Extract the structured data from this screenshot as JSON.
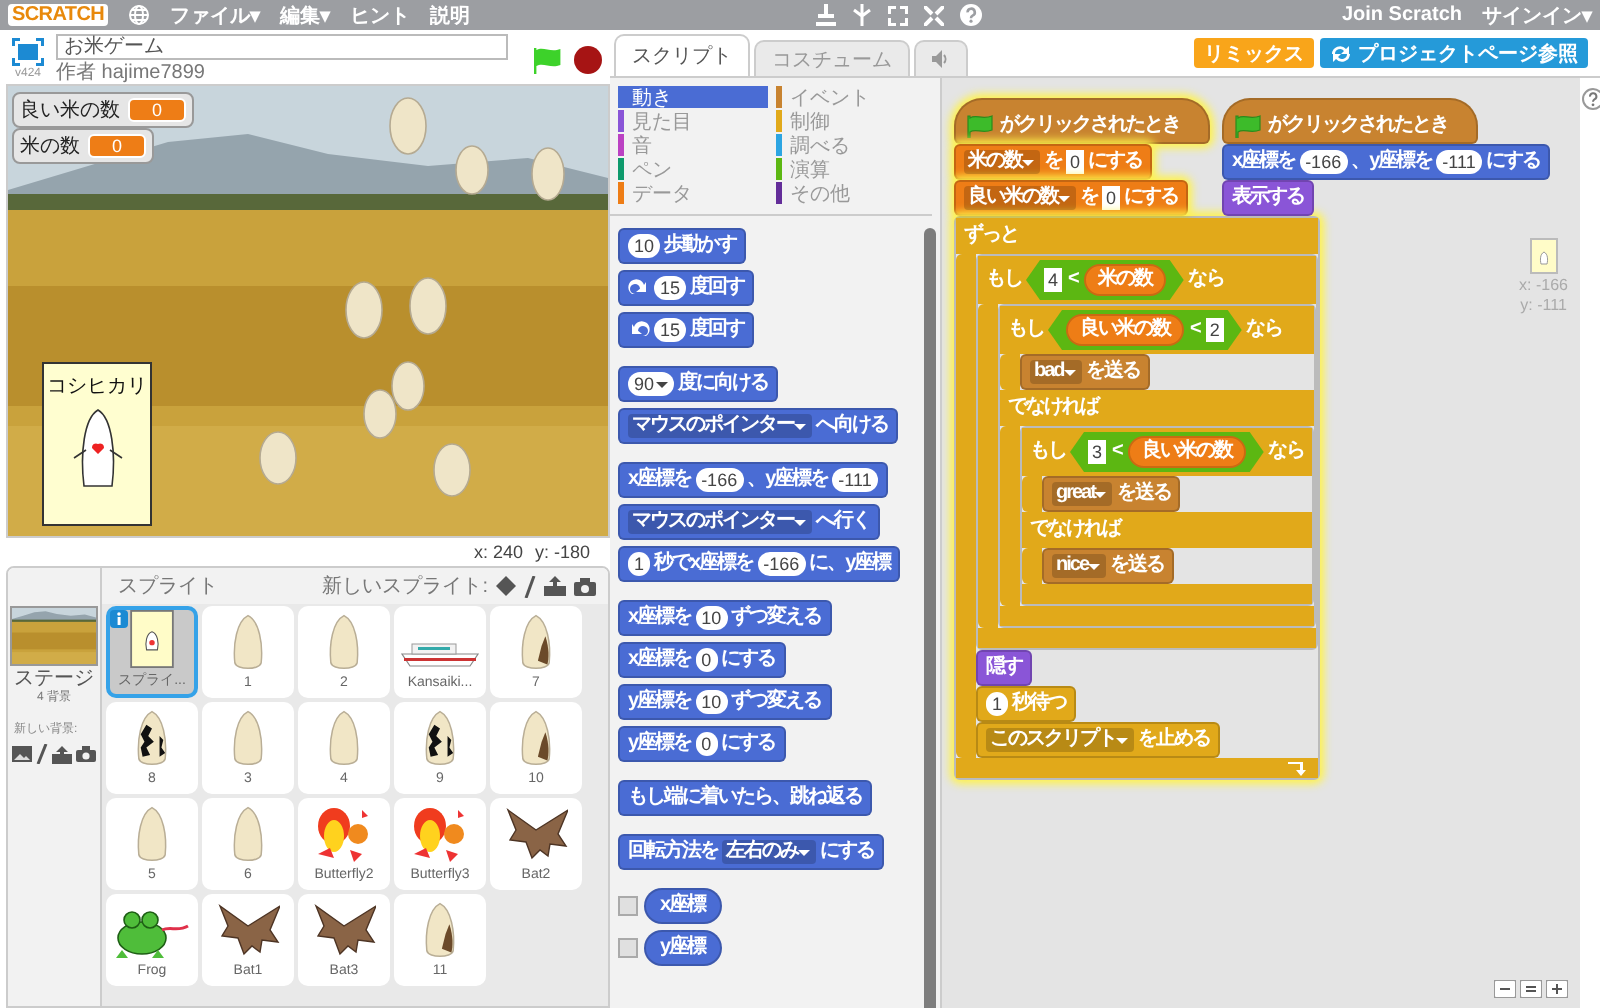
{
  "menubar": {
    "logo": "SCRATCH",
    "menus": [
      "ファイル▾",
      "編集▾",
      "ヒント",
      "説明"
    ],
    "account": [
      "Join Scratch",
      "サインイン▾"
    ]
  },
  "project": {
    "title": "お米ゲーム",
    "author": "作者 hajime7899",
    "version": "v424"
  },
  "stage": {
    "monitors": [
      {
        "label": "良い米の数",
        "value": "0"
      },
      {
        "label": "米の数",
        "value": "0"
      }
    ],
    "card_text": "コシヒカリ",
    "readout_x": "x: 240",
    "readout_y": "y: -180"
  },
  "sprites_pane": {
    "stage_label": "ステージ",
    "backdrop_count": "4 背景",
    "new_backdrop": "新しい背景:",
    "title": "スプライト",
    "new_sprite": "新しいスプライト:",
    "sprites": [
      {
        "name": "スプライ...",
        "kind": "card",
        "selected": true
      },
      {
        "name": "1",
        "kind": "grain",
        "selected": false
      },
      {
        "name": "2",
        "kind": "grain",
        "selected": false
      },
      {
        "name": "Kansaiki...",
        "kind": "ship",
        "selected": false
      },
      {
        "name": "7",
        "kind": "brown-grain",
        "selected": false
      },
      {
        "name": "8",
        "kind": "spotted-grain",
        "selected": false
      },
      {
        "name": "3",
        "kind": "grain",
        "selected": false
      },
      {
        "name": "4",
        "kind": "grain",
        "selected": false
      },
      {
        "name": "9",
        "kind": "spotted-grain",
        "selected": false
      },
      {
        "name": "10",
        "kind": "brown-grain",
        "selected": false
      },
      {
        "name": "5",
        "kind": "grain",
        "selected": false
      },
      {
        "name": "6",
        "kind": "grain",
        "selected": false
      },
      {
        "name": "Butterfly2",
        "kind": "dragon",
        "selected": false
      },
      {
        "name": "Butterfly3",
        "kind": "dragon",
        "selected": false
      },
      {
        "name": "Bat2",
        "kind": "bat",
        "selected": false
      },
      {
        "name": "Frog",
        "kind": "frog",
        "selected": false
      },
      {
        "name": "Bat1",
        "kind": "bat",
        "selected": false
      },
      {
        "name": "Bat3",
        "kind": "bat",
        "selected": false
      },
      {
        "name": "11",
        "kind": "brown-grain",
        "selected": false
      }
    ]
  },
  "tabs": [
    {
      "kind": "text",
      "label": "スクリプト",
      "selected": true
    },
    {
      "kind": "text",
      "label": "コスチューム",
      "selected": false
    },
    {
      "kind": "sound",
      "selected": false
    }
  ],
  "buttons": [
    {
      "kind": "remix",
      "label": "リミックス"
    },
    {
      "kind": "project-page",
      "label": "プロジェクトページ参照"
    }
  ],
  "palette": {
    "categories": [
      {
        "label": "動き",
        "color": "#4a6cd4",
        "selected": true
      },
      {
        "label": "見た目",
        "color": "#8a55d7",
        "selected": false
      },
      {
        "label": "音",
        "color": "#bb42c3",
        "selected": false
      },
      {
        "label": "ペン",
        "color": "#0e9a6c",
        "selected": false
      },
      {
        "label": "データ",
        "color": "#ee7d16",
        "selected": false
      },
      {
        "label": "イベント",
        "color": "#c88330",
        "selected": false
      },
      {
        "label": "制御",
        "color": "#e1a91a",
        "selected": false
      },
      {
        "label": "調べる",
        "color": "#2ca5e2",
        "selected": false
      },
      {
        "label": "演算",
        "color": "#5cb712",
        "selected": false
      },
      {
        "label": "その他",
        "color": "#632d99",
        "selected": false
      }
    ],
    "groups": [
      [
        {
          "kind": "stack",
          "color": "#4a6cd4",
          "parts": [
            {
              "kind": "number",
              "text": "10"
            },
            {
              "kind": "text",
              "text": "歩動かす"
            }
          ]
        },
        {
          "kind": "stack",
          "color": "#4a6cd4",
          "parts": [
            {
              "kind": "turn-right"
            },
            {
              "kind": "number",
              "text": "15"
            },
            {
              "kind": "text",
              "text": "度回す"
            }
          ]
        },
        {
          "kind": "stack",
          "color": "#4a6cd4",
          "parts": [
            {
              "kind": "turn-left"
            },
            {
              "kind": "number",
              "text": "15"
            },
            {
              "kind": "text",
              "text": "度回す"
            }
          ]
        }
      ],
      [
        {
          "kind": "stack",
          "color": "#4a6cd4",
          "parts": [
            {
              "kind": "numdrop",
              "text": "90"
            },
            {
              "kind": "text",
              "text": "度に向ける"
            }
          ]
        },
        {
          "kind": "stack",
          "color": "#4a6cd4",
          "parts": [
            {
              "kind": "dropdown",
              "text": "マウスのポインター"
            },
            {
              "kind": "text",
              "text": "へ向ける"
            }
          ]
        }
      ],
      [
        {
          "kind": "stack",
          "color": "#4a6cd4",
          "parts": [
            {
              "kind": "text",
              "text": "x座標を"
            },
            {
              "kind": "number",
              "text": "-166"
            },
            {
              "kind": "text",
              "text": "、y座標を"
            },
            {
              "kind": "number",
              "text": "-111"
            }
          ]
        },
        {
          "kind": "stack",
          "color": "#4a6cd4",
          "parts": [
            {
              "kind": "dropdown",
              "text": "マウスのポインター"
            },
            {
              "kind": "text",
              "text": "へ行く"
            }
          ]
        },
        {
          "kind": "stack",
          "color": "#4a6cd4",
          "parts": [
            {
              "kind": "number",
              "text": "1"
            },
            {
              "kind": "text",
              "text": "秒でx座標を"
            },
            {
              "kind": "number",
              "text": "-166"
            },
            {
              "kind": "text",
              "text": "に、y座標"
            }
          ]
        }
      ],
      [
        {
          "kind": "stack",
          "color": "#4a6cd4",
          "parts": [
            {
              "kind": "text",
              "text": "x座標を"
            },
            {
              "kind": "number",
              "text": "10"
            },
            {
              "kind": "text",
              "text": "ずつ変える"
            }
          ]
        },
        {
          "kind": "stack",
          "color": "#4a6cd4",
          "parts": [
            {
              "kind": "text",
              "text": "x座標を"
            },
            {
              "kind": "number",
              "text": "0"
            },
            {
              "kind": "text",
              "text": "にする"
            }
          ]
        },
        {
          "kind": "stack",
          "color": "#4a6cd4",
          "parts": [
            {
              "kind": "text",
              "text": "y座標を"
            },
            {
              "kind": "number",
              "text": "10"
            },
            {
              "kind": "text",
              "text": "ずつ変える"
            }
          ]
        },
        {
          "kind": "stack",
          "color": "#4a6cd4",
          "parts": [
            {
              "kind": "text",
              "text": "y座標を"
            },
            {
              "kind": "number",
              "text": "0"
            },
            {
              "kind": "text",
              "text": "にする"
            }
          ]
        }
      ],
      [
        {
          "kind": "stack",
          "color": "#4a6cd4",
          "parts": [
            {
              "kind": "text",
              "text": "もし端に着いたら、跳ね返る"
            }
          ]
        }
      ],
      [
        {
          "kind": "stack",
          "color": "#4a6cd4",
          "parts": [
            {
              "kind": "text",
              "text": "回転方法を"
            },
            {
              "kind": "dropdown",
              "text": "左右のみ"
            },
            {
              "kind": "text",
              "text": "にする"
            }
          ]
        }
      ],
      [
        {
          "kind": "reporter",
          "color": "#4a6cd4",
          "checked": false,
          "text": "x座標"
        },
        {
          "kind": "reporter",
          "color": "#4a6cd4",
          "checked": false,
          "text": "y座標"
        }
      ]
    ]
  },
  "scripts": [
    {
      "running": true,
      "blocks": [
        {
          "kind": "hat",
          "color": "#c88330",
          "parts": [
            {
              "kind": "flag"
            },
            {
              "kind": "text",
              "text": "がクリックされたとき"
            }
          ]
        },
        {
          "kind": "stack",
          "color": "#ee7d16",
          "parts": [
            {
              "kind": "dropdown",
              "text": "米の数"
            },
            {
              "kind": "text",
              "text": "を"
            },
            {
              "kind": "string",
              "text": "0"
            },
            {
              "kind": "text",
              "text": "にする"
            }
          ]
        },
        {
          "kind": "stack",
          "color": "#ee7d16",
          "parts": [
            {
              "kind": "dropdown",
              "text": "良い米の数"
            },
            {
              "kind": "text",
              "text": "を"
            },
            {
              "kind": "string",
              "text": "0"
            },
            {
              "kind": "text",
              "text": "にする"
            }
          ]
        },
        {
          "kind": "c",
          "color": "#e1a91a",
          "loop": true,
          "parts": [
            {
              "kind": "text",
              "text": "ずっと"
            }
          ],
          "body": [
            {
              "kind": "c",
              "color": "#e1a91a",
              "loop": false,
              "parts": [
                {
                  "kind": "text",
                  "text": "もし"
                },
                {
                  "kind": "boolean",
                  "parts": [
                    {
                      "kind": "string",
                      "text": "4"
                    },
                    {
                      "kind": "text",
                      "text": "<"
                    },
                    {
                      "kind": "reporter",
                      "color": "#ee7d16",
                      "text": "米の数"
                    }
                  ]
                },
                {
                  "kind": "text",
                  "text": "なら"
                }
              ],
              "body": [
                {
                  "kind": "ifelse",
                  "color": "#e1a91a",
                  "parts": [
                    {
                      "kind": "text",
                      "text": "もし"
                    },
                    {
                      "kind": "boolean",
                      "parts": [
                        {
                          "kind": "reporter",
                          "color": "#ee7d16",
                          "text": "良い米の数"
                        },
                        {
                          "kind": "text",
                          "text": "<"
                        },
                        {
                          "kind": "string",
                          "text": "2"
                        }
                      ]
                    },
                    {
                      "kind": "text",
                      "text": "なら"
                    }
                  ],
                  "body": [
                    {
                      "kind": "stack",
                      "color": "#c88330",
                      "parts": [
                        {
                          "kind": "dropdown",
                          "text": "bad"
                        },
                        {
                          "kind": "text",
                          "text": "を送る"
                        }
                      ]
                    }
                  ],
                  "else_label": "でなければ",
                  "else_body": [
                    {
                      "kind": "ifelse",
                      "color": "#e1a91a",
                      "parts": [
                        {
                          "kind": "text",
                          "text": "もし"
                        },
                        {
                          "kind": "boolean",
                          "parts": [
                            {
                              "kind": "string",
                              "text": "3"
                            },
                            {
                              "kind": "text",
                              "text": "<"
                            },
                            {
                              "kind": "reporter",
                              "color": "#ee7d16",
                              "text": "良い米の数"
                            }
                          ]
                        },
                        {
                          "kind": "text",
                          "text": "なら"
                        }
                      ],
                      "body": [
                        {
                          "kind": "stack",
                          "color": "#c88330",
                          "parts": [
                            {
                              "kind": "dropdown",
                              "text": "great"
                            },
                            {
                              "kind": "text",
                              "text": "を送る"
                            }
                          ]
                        }
                      ],
                      "else_label": "でなければ",
                      "else_body": [
                        {
                          "kind": "stack",
                          "color": "#c88330",
                          "parts": [
                            {
                              "kind": "dropdown",
                              "text": "nice"
                            },
                            {
                              "kind": "text",
                              "text": "を送る"
                            }
                          ]
                        }
                      ]
                    }
                  ]
                }
              ]
            },
            {
              "kind": "stack",
              "color": "#8a55d7",
              "parts": [
                {
                  "kind": "text",
                  "text": "隠す"
                }
              ]
            },
            {
              "kind": "stack",
              "color": "#e1a91a",
              "parts": [
                {
                  "kind": "number",
                  "text": "1"
                },
                {
                  "kind": "text",
                  "text": "秒待つ"
                }
              ]
            },
            {
              "kind": "stack",
              "color": "#e1a91a",
              "parts": [
                {
                  "kind": "dropdown",
                  "text": "このスクリプト"
                },
                {
                  "kind": "text",
                  "text": "を止める"
                }
              ]
            }
          ]
        }
      ]
    },
    {
      "running": false,
      "blocks": [
        {
          "kind": "hat",
          "color": "#c88330",
          "parts": [
            {
              "kind": "flag"
            },
            {
              "kind": "text",
              "text": "がクリックされたとき"
            }
          ]
        },
        {
          "kind": "stack",
          "color": "#4a6cd4",
          "parts": [
            {
              "kind": "text",
              "text": "x座標を"
            },
            {
              "kind": "number",
              "text": "-166"
            },
            {
              "kind": "text",
              "text": "、y座標を"
            },
            {
              "kind": "number",
              "text": "-111"
            },
            {
              "kind": "text",
              "text": "にする"
            }
          ]
        },
        {
          "kind": "stack",
          "color": "#8a55d7",
          "parts": [
            {
              "kind": "text",
              "text": "表示する"
            }
          ]
        }
      ]
    }
  ],
  "sprite_info": {
    "x": "x: -166",
    "y": "y: -111"
  }
}
